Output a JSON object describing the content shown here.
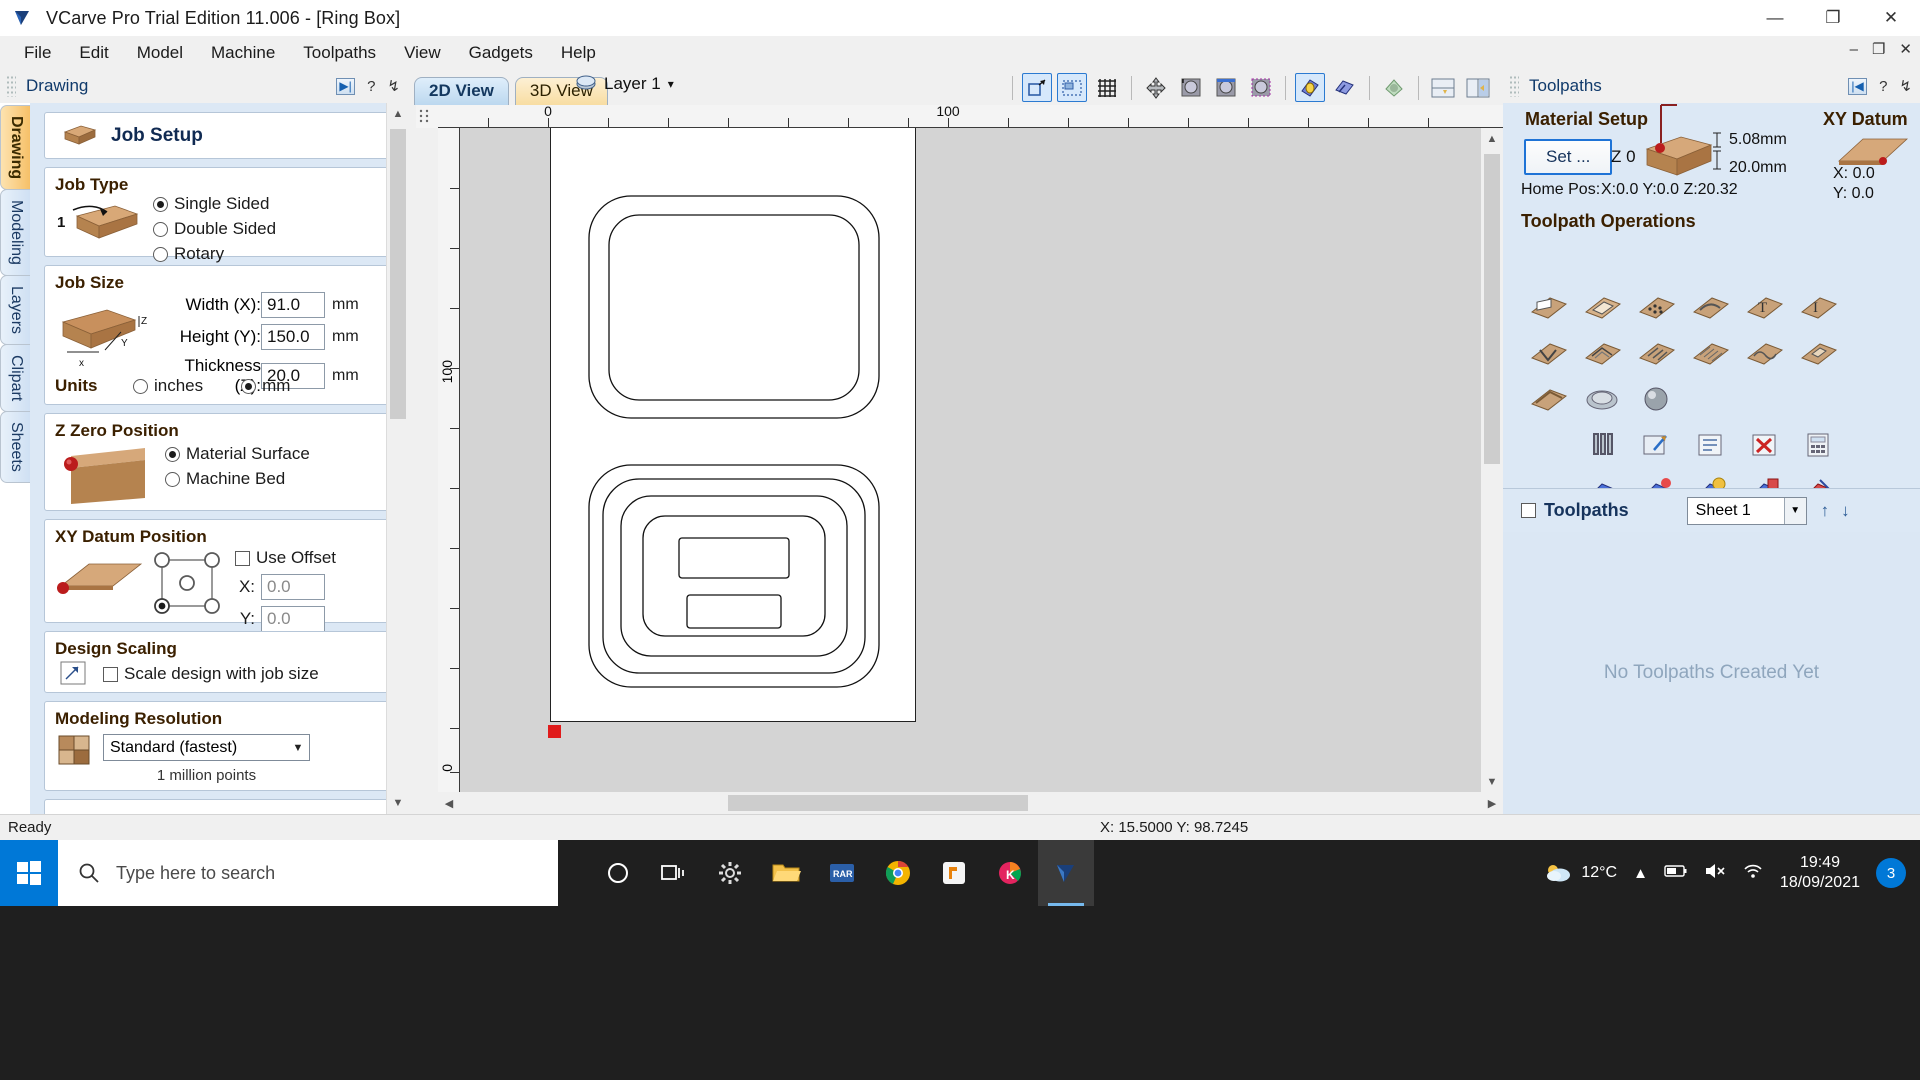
{
  "window": {
    "title": "VCarve Pro Trial Edition 11.006 - [Ring Box]",
    "minimize": "—",
    "maximize": "❐",
    "close": "✕",
    "inner_minimize": "–",
    "inner_restore": "❐",
    "inner_close": "✕"
  },
  "menu": {
    "items": [
      "File",
      "Edit",
      "Model",
      "Machine",
      "Toolpaths",
      "View",
      "Gadgets",
      "Help"
    ]
  },
  "left_panel": {
    "header_title": "Drawing",
    "help_icon": "?",
    "pin_icon": "↯",
    "tabs": [
      {
        "label": "Drawing",
        "active": true
      },
      {
        "label": "Modeling",
        "active": false
      },
      {
        "label": "Layers",
        "active": false
      },
      {
        "label": "Clipart",
        "active": false
      },
      {
        "label": "Sheets",
        "active": false
      }
    ],
    "job_setup_title": "Job Setup",
    "job_type": {
      "title": "Job Type",
      "badge": "1",
      "options": [
        {
          "label": "Single Sided",
          "selected": true
        },
        {
          "label": "Double Sided",
          "selected": false
        },
        {
          "label": "Rotary",
          "selected": false
        }
      ]
    },
    "job_size": {
      "title": "Job Size",
      "width_label": "Width (X):",
      "width_value": "91.0",
      "width_unit": "mm",
      "height_label": "Height (Y):",
      "height_value": "150.0",
      "height_unit": "mm",
      "thickness_label": "Thickness (Z):",
      "thickness_value": "20.0",
      "thickness_unit": "mm",
      "units_label": "Units",
      "units_options": [
        {
          "label": "inches",
          "selected": false
        },
        {
          "label": "mm",
          "selected": true
        }
      ],
      "axis_x": "X",
      "axis_y": "Y",
      "axis_z": "Z"
    },
    "z_zero": {
      "title": "Z Zero Position",
      "options": [
        {
          "label": "Material Surface",
          "selected": true
        },
        {
          "label": "Machine Bed",
          "selected": false
        }
      ]
    },
    "xy_datum": {
      "title": "XY Datum Position",
      "use_offset_label": "Use Offset",
      "use_offset_checked": false,
      "x_label": "X:",
      "x_value": "0.0",
      "y_label": "Y:",
      "y_value": "0.0",
      "selected_corner": "bottom-left"
    },
    "design_scaling": {
      "title": "Design Scaling",
      "checkbox_label": "Scale design with job size",
      "checked": false
    },
    "modeling_resolution": {
      "title": "Modeling Resolution",
      "selected": "Standard (fastest)",
      "points_note": "1 million points"
    }
  },
  "center": {
    "tabs": [
      {
        "label": "2D View",
        "selected": true
      },
      {
        "label": "3D View",
        "selected": false
      }
    ],
    "layer_name": "Layer 1",
    "layer_caret": "▾",
    "toolbar_icons": [
      "zoom-to-selection-icon",
      "zoom-to-drawing-icon",
      "toggle-grid-icon",
      "pan-icon",
      "zoom-in-icon",
      "zoom-out-icon",
      "zoom-extents-icon",
      "show-toolpaths-icon",
      "toolpath-preview-icon",
      "3d-model-icon",
      "split-view-horizontal-icon",
      "split-view-vertical-icon"
    ],
    "ruler_top_labels": [
      "0",
      "100"
    ],
    "ruler_left_labels": [
      "100",
      "0"
    ]
  },
  "right_panel": {
    "header_title": "Toolpaths",
    "help_icon": "?",
    "pin_icon": "↯",
    "material_setup": {
      "title": "Material Setup",
      "set_button": "Set ...",
      "z_label": "Z 0",
      "above_value": "5.08mm",
      "thickness_value": "20.0mm",
      "home_pos_label": "Home Pos:",
      "home_pos_value": "X:0.0 Y:0.0 Z:20.32"
    },
    "xy_datum": {
      "title": "XY Datum",
      "x_value": "X: 0.0",
      "y_value": "Y: 0.0"
    },
    "toolpath_operations": {
      "title": "Toolpath Operations",
      "icons": [
        "profile-toolpath-icon",
        "pocket-toolpath-icon",
        "drilling-toolpath-icon",
        "quick-engrave-icon",
        "vcarve-text-icon",
        "text-toolpath-icon",
        "vcarve-toolpath-icon",
        "prism-carve-icon",
        "fluting-toolpath-icon",
        "texture-toolpath-icon",
        "molding-toolpath-icon",
        "inlay-toolpath-icon",
        "chamfer-toolpath-icon",
        "3d-rough-toolpath-icon",
        "3d-finish-toolpath-icon",
        "tool-database-icon",
        "edit-toolpath-icon",
        "toolpath-list-icon",
        "delete-toolpath-icon",
        "estimate-time-icon",
        "preview-toolpath-icon",
        "preview-all-icon",
        "save-toolpath-icon",
        "simulate-toolpath-icon",
        "toolpath-summary-icon",
        "toolpath-tiling-icon",
        "toolpath-timer-icon",
        "nesting-icon",
        "toolpath-settings-icon",
        "save-all-toolpaths-icon"
      ]
    },
    "toolpaths_list": {
      "checkbox_label": "Toolpaths",
      "checked": false,
      "sheet_selected": "Sheet 1",
      "move_up_icon": "↑",
      "move_down_icon": "↓",
      "empty_message": "No Toolpaths Created Yet"
    }
  },
  "status_bar": {
    "message": "Ready",
    "coordinates": "X: 15.5000 Y: 98.7245"
  },
  "taskbar": {
    "start_icon": "windows-icon",
    "search_placeholder": "Type here to search",
    "search_icon": "search-icon",
    "apps": [
      {
        "name": "cortana-icon",
        "active": false
      },
      {
        "name": "task-view-icon",
        "active": false
      },
      {
        "name": "settings-icon",
        "active": false
      },
      {
        "name": "file-explorer-icon",
        "active": false
      },
      {
        "name": "winrar-icon",
        "active": false,
        "label": "RAR"
      },
      {
        "name": "chrome-icon",
        "active": false
      },
      {
        "name": "app-orange-icon",
        "active": false
      },
      {
        "name": "kaspersky-icon",
        "active": false,
        "label": "K"
      },
      {
        "name": "vcarve-icon",
        "active": true
      }
    ],
    "weather_icon": "partly-cloudy-icon",
    "weather_temp": "12°C",
    "tray_icons": [
      "chevron-up-icon",
      "battery-icon",
      "volume-mute-icon",
      "network-icon"
    ],
    "time": "19:49",
    "date": "18/09/2021",
    "notification_count": "3"
  },
  "colors": {
    "accent_blue": "#0078d7",
    "panel_blue": "#dce8f5",
    "title_brown": "#3b2000",
    "wood": "#c99a68"
  }
}
